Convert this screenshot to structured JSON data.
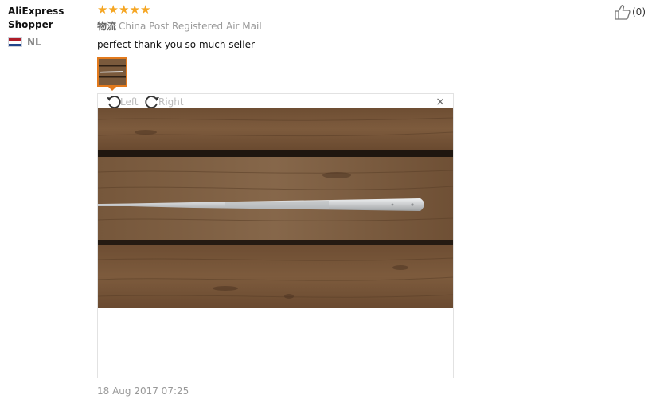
{
  "reviewer": {
    "name": "AliExpress Shopper",
    "country": "NL",
    "flag_colors": [
      "#ae1c28",
      "#ffffff",
      "#21468b"
    ]
  },
  "review": {
    "rating": 5,
    "max_rating": 5,
    "star_glyph": "★",
    "star_color": "#f5a623",
    "shipping_label": "物流",
    "shipping_method": "China Post Registered Air Mail",
    "text": "perfect thank you so much seller",
    "date": "18 Aug 2017 07:25"
  },
  "viewer": {
    "rotate_left_label": "Left",
    "rotate_right_label": "Right",
    "close_glyph": "×"
  },
  "helpful": {
    "count": "(0)",
    "icon": "thumbs-up-icon"
  },
  "colors": {
    "accent": "#e27a1d",
    "star": "#f5a623",
    "muted_text": "#999999"
  }
}
